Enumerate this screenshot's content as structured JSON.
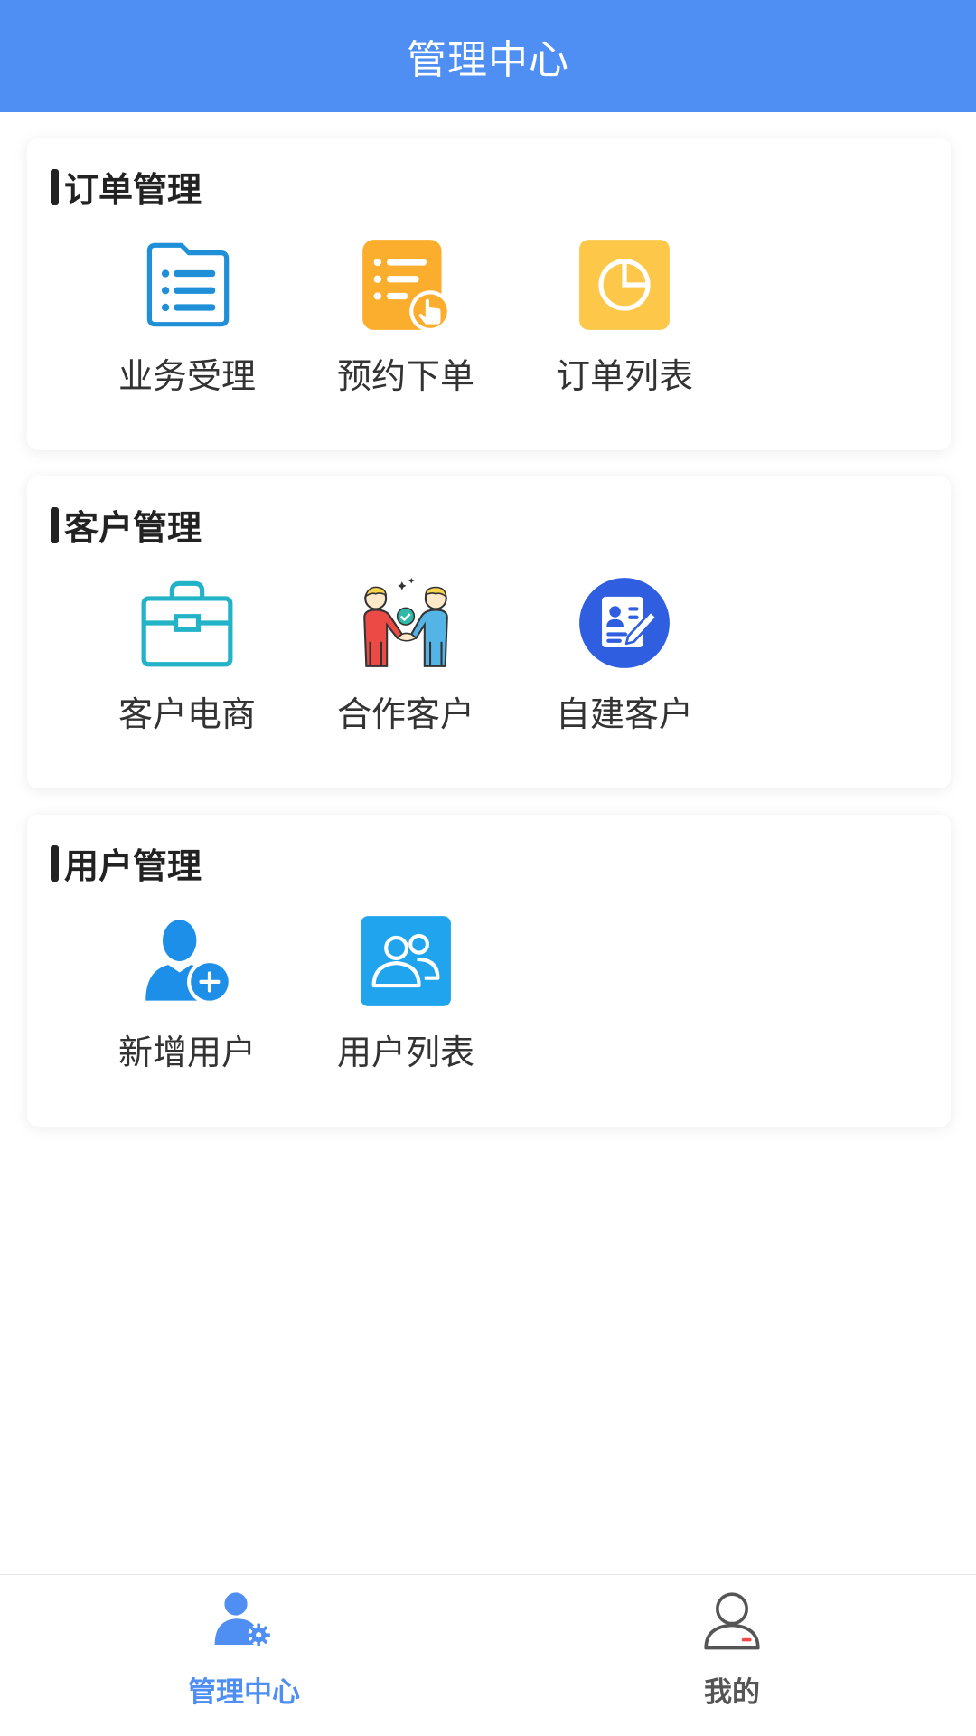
{
  "header": {
    "title": "管理中心"
  },
  "sections": [
    {
      "title": "订单管理",
      "items": [
        {
          "label": "业务受理",
          "icon": "folder-list-icon"
        },
        {
          "label": "预约下单",
          "icon": "checklist-hand-icon"
        },
        {
          "label": "订单列表",
          "icon": "pie-chart-icon"
        }
      ]
    },
    {
      "title": "客户管理",
      "items": [
        {
          "label": "客户电商",
          "icon": "briefcase-icon"
        },
        {
          "label": "合作客户",
          "icon": "handshake-icon"
        },
        {
          "label": "自建客户",
          "icon": "id-card-edit-icon"
        }
      ]
    },
    {
      "title": "用户管理",
      "items": [
        {
          "label": "新增用户",
          "icon": "add-user-icon"
        },
        {
          "label": "用户列表",
          "icon": "users-icon"
        }
      ]
    }
  ],
  "tabbar": {
    "items": [
      {
        "label": "管理中心",
        "icon": "user-gear-icon",
        "active": true
      },
      {
        "label": "我的",
        "icon": "person-outline-icon",
        "active": false
      }
    ]
  },
  "colors": {
    "primary": "#4f8ef2",
    "header_bg": "#4f8ef2",
    "title_text": "#222222",
    "label_text": "#333333"
  }
}
